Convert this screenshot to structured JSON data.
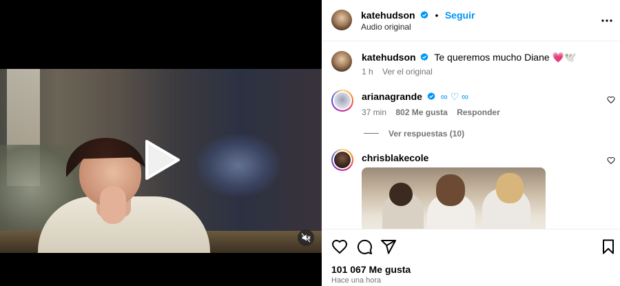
{
  "media": {
    "play_icon": "play-icon",
    "mute_icon": "muted-speaker-icon"
  },
  "header": {
    "username": "katehudson",
    "separator": "•",
    "follow_label": "Seguir",
    "subtitle": "Audio original",
    "more_icon": "more-horizontal-icon"
  },
  "caption": {
    "username": "katehudson",
    "text": "Te queremos mucho Diane 💗🕊️",
    "time": "1 h",
    "translate_label": "Ver el original"
  },
  "comments": [
    {
      "username": "arianagrande",
      "text": "∞ ♡ ∞",
      "time": "37 min",
      "likes": "802 Me gusta",
      "reply_label": "Responder",
      "view_replies": "Ver respuestas (10)"
    },
    {
      "username": "chrisblakecole"
    }
  ],
  "actions": {
    "likes": "101 067 Me gusta",
    "timestamp": "Hace una hora"
  },
  "colors": {
    "link_blue": "#0095f6",
    "secondary_text": "#737373",
    "divider": "#efefef",
    "verified_blue": "#0095f6"
  }
}
